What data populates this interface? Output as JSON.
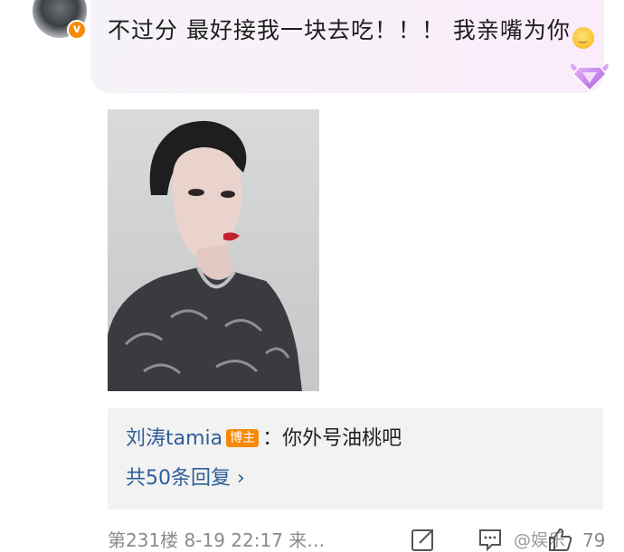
{
  "comment": {
    "text": "不过分 最好接我一块去吃！！！ 我亲嘴为你",
    "emoji_icon": "smiling-face-emoji",
    "badge_icon": "gem-badge-icon",
    "verified_mark": "v"
  },
  "reply": {
    "author": "刘涛tamia",
    "badge": "博主",
    "separator": "：",
    "text": "你外号油桃吧",
    "more_link": "共50条回复 ›"
  },
  "footer": {
    "meta": "第231楼  8-19 22:17  来…",
    "watermark": "@娱乐",
    "like_count": "79"
  },
  "colors": {
    "link": "#2f5d99",
    "badge": "#f58a0a",
    "reply_bg": "#f2f2f2",
    "meta": "#8a8a8a"
  }
}
